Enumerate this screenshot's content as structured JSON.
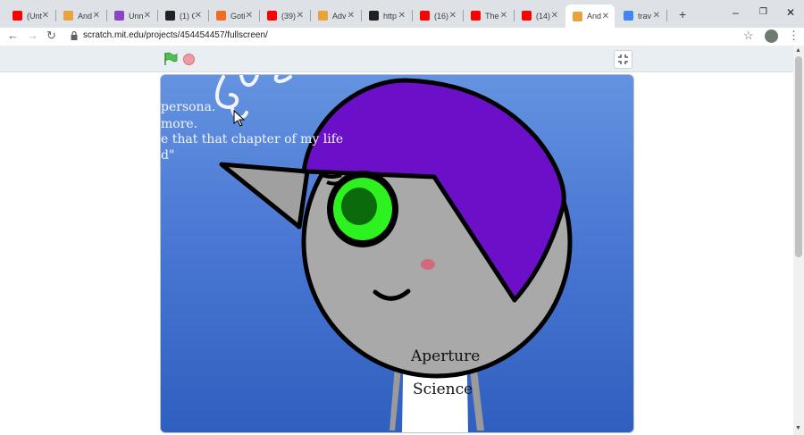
{
  "tabs": [
    {
      "title": "(Unt",
      "favicon": "youtube-icon",
      "color": "#ff0000"
    },
    {
      "title": "And",
      "favicon": "page-icon",
      "color": "#e8a33d"
    },
    {
      "title": "Unn",
      "favicon": "twitch-icon",
      "color": "#8c44c4"
    },
    {
      "title": "(1) C",
      "favicon": "alt-icon",
      "color": "#222222"
    },
    {
      "title": "Goti",
      "favicon": "cloud-icon",
      "color": "#f26d21"
    },
    {
      "title": "(39)",
      "favicon": "youtube-icon",
      "color": "#ff0000"
    },
    {
      "title": "Adv",
      "favicon": "page-icon",
      "color": "#e8a33d"
    },
    {
      "title": "http",
      "favicon": "film-icon",
      "color": "#202020"
    },
    {
      "title": "(16)",
      "favicon": "youtube-icon",
      "color": "#ff0000"
    },
    {
      "title": "The",
      "favicon": "youtube-icon",
      "color": "#ff0000"
    },
    {
      "title": "(14)",
      "favicon": "youtube-icon",
      "color": "#ff0000"
    },
    {
      "title": "And",
      "favicon": "page-icon",
      "color": "#e8a33d",
      "active": true
    },
    {
      "title": "trav",
      "favicon": "google-icon",
      "color": "#4285f4"
    }
  ],
  "url": "scratch.mit.edu/projects/454454457/fullscreen/",
  "stage": {
    "text_lines": [
      "persona.",
      "more.",
      "e that that chapter of my life",
      "d\""
    ],
    "shirt_text": [
      "Aperture",
      "Science"
    ]
  },
  "colors": {
    "hair": "#6b0fc9",
    "eye": "#2df21f",
    "pupil": "#0b6a0b",
    "skin": "#a9a9a9",
    "blush": "#d06a7e"
  }
}
